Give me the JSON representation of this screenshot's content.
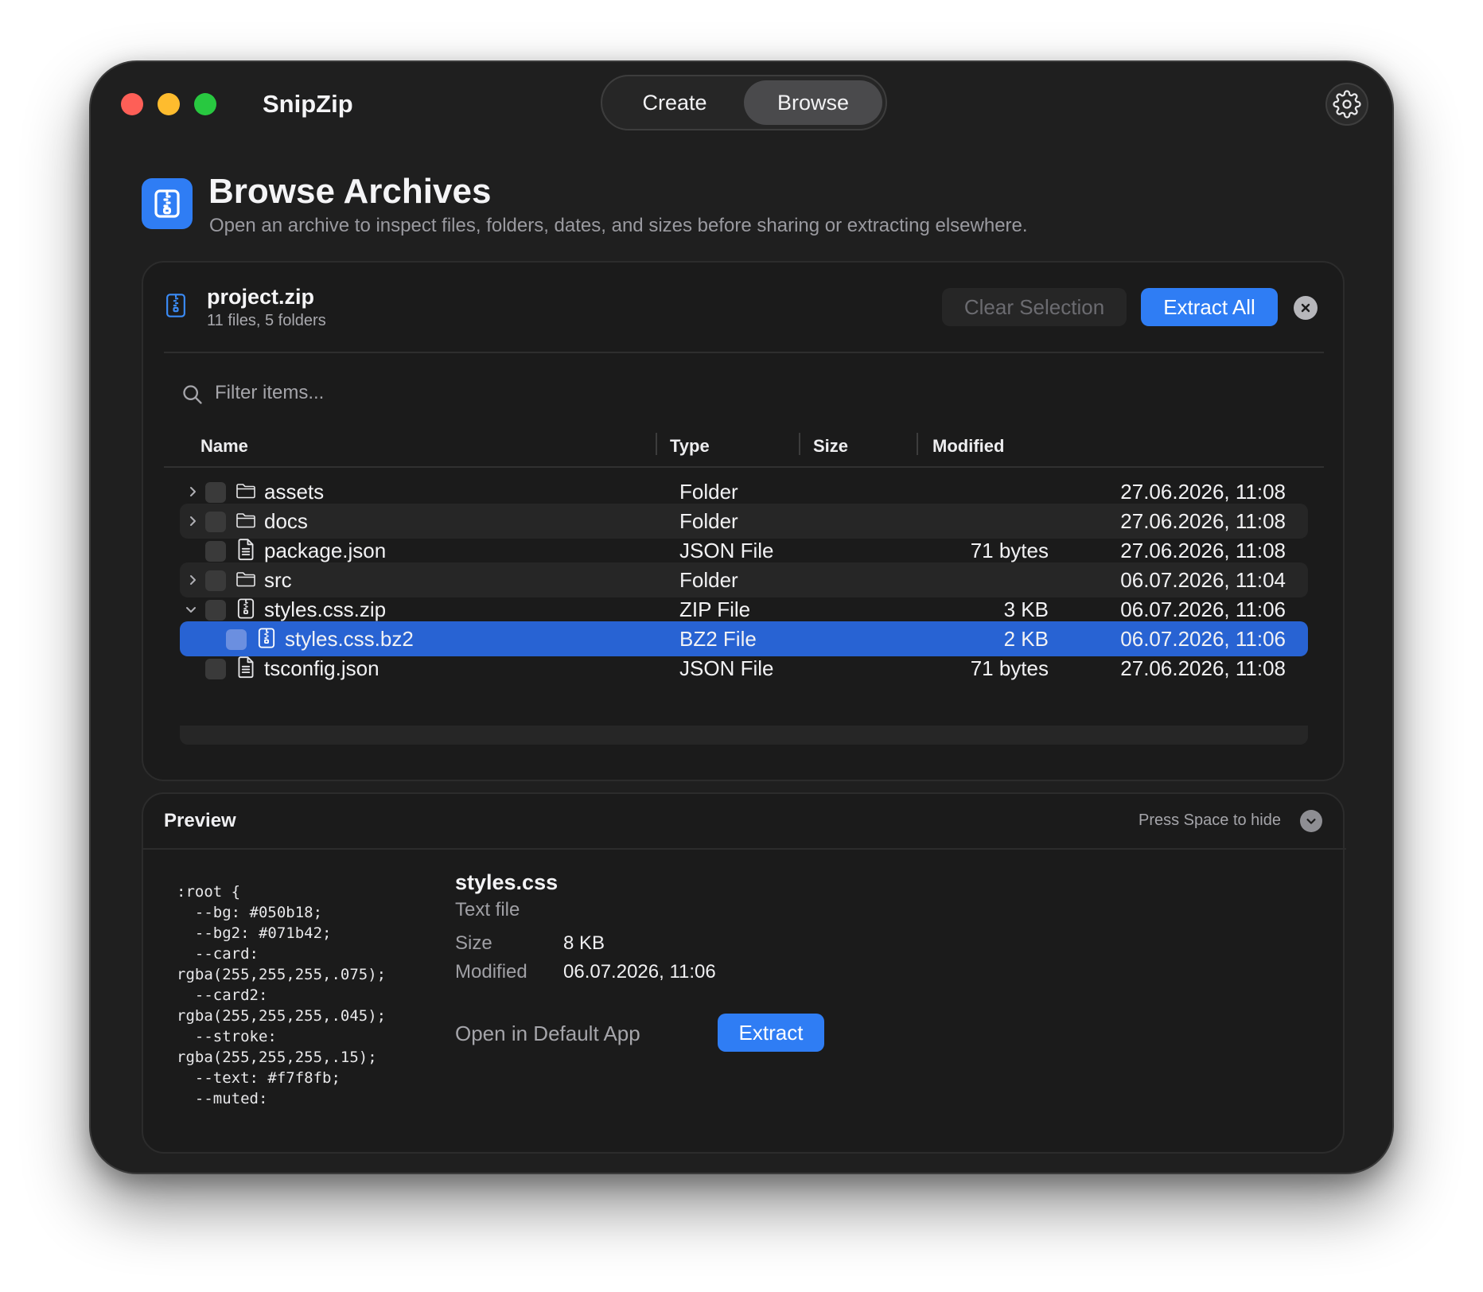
{
  "app": {
    "title": "SnipZip"
  },
  "mode_tabs": [
    {
      "label": "Create",
      "active": false
    },
    {
      "label": "Browse",
      "active": true
    }
  ],
  "header": {
    "title": "Browse Archives",
    "subtitle": "Open an archive to inspect files, folders, dates, and sizes before sharing or extracting elsewhere."
  },
  "archive": {
    "name": "project.zip",
    "meta": "11 files, 5 folders",
    "clear_selection_label": "Clear Selection",
    "extract_all_label": "Extract All"
  },
  "filter": {
    "placeholder": "Filter items..."
  },
  "table": {
    "columns": {
      "name": "Name",
      "type": "Type",
      "size": "Size",
      "modified": "Modified"
    },
    "rows": [
      {
        "name": "assets",
        "type": "Folder",
        "size": "",
        "modified": "27.06.2026, 11:08",
        "icon": "folder-icon",
        "chevron": "right",
        "depth": 0,
        "selected": false
      },
      {
        "name": "docs",
        "type": "Folder",
        "size": "",
        "modified": "27.06.2026, 11:08",
        "icon": "folder-icon",
        "chevron": "right",
        "depth": 0,
        "selected": false
      },
      {
        "name": "package.json",
        "type": "JSON File",
        "size": "71 bytes",
        "modified": "27.06.2026, 11:08",
        "icon": "document-icon",
        "chevron": "none",
        "depth": 0,
        "selected": false
      },
      {
        "name": "src",
        "type": "Folder",
        "size": "",
        "modified": "06.07.2026, 11:04",
        "icon": "folder-icon",
        "chevron": "right",
        "depth": 0,
        "selected": false
      },
      {
        "name": "styles.css.zip",
        "type": "ZIP File",
        "size": "3 KB",
        "modified": "06.07.2026, 11:06",
        "icon": "zip-icon",
        "chevron": "down",
        "depth": 0,
        "selected": false
      },
      {
        "name": "styles.css.bz2",
        "type": "BZ2 File",
        "size": "2 KB",
        "modified": "06.07.2026, 11:06",
        "icon": "zip-icon",
        "chevron": "none",
        "depth": 1,
        "selected": true
      },
      {
        "name": "tsconfig.json",
        "type": "JSON File",
        "size": "71 bytes",
        "modified": "27.06.2026, 11:08",
        "icon": "document-icon",
        "chevron": "none",
        "depth": 0,
        "selected": false
      }
    ]
  },
  "preview": {
    "title": "Preview",
    "hint": "Press Space to hide",
    "code": ":root {\n  --bg: #050b18;\n  --bg2: #071b42;\n  --card:\nrgba(255,255,255,.075);\n  --card2:\nrgba(255,255,255,.045);\n  --stroke:\nrgba(255,255,255,.15);\n  --text: #f7f8fb;\n  --muted:",
    "file_name": "styles.css",
    "file_kind": "Text file",
    "size_label": "Size",
    "size_value": "8 KB",
    "modified_label": "Modified",
    "modified_value": "06.07.2026, 11:06",
    "open_label": "Open in Default App",
    "extract_label": "Extract"
  },
  "colors": {
    "accent": "#2f7df4",
    "selection": "#2863d3",
    "window_bg": "#1f1f1f"
  }
}
